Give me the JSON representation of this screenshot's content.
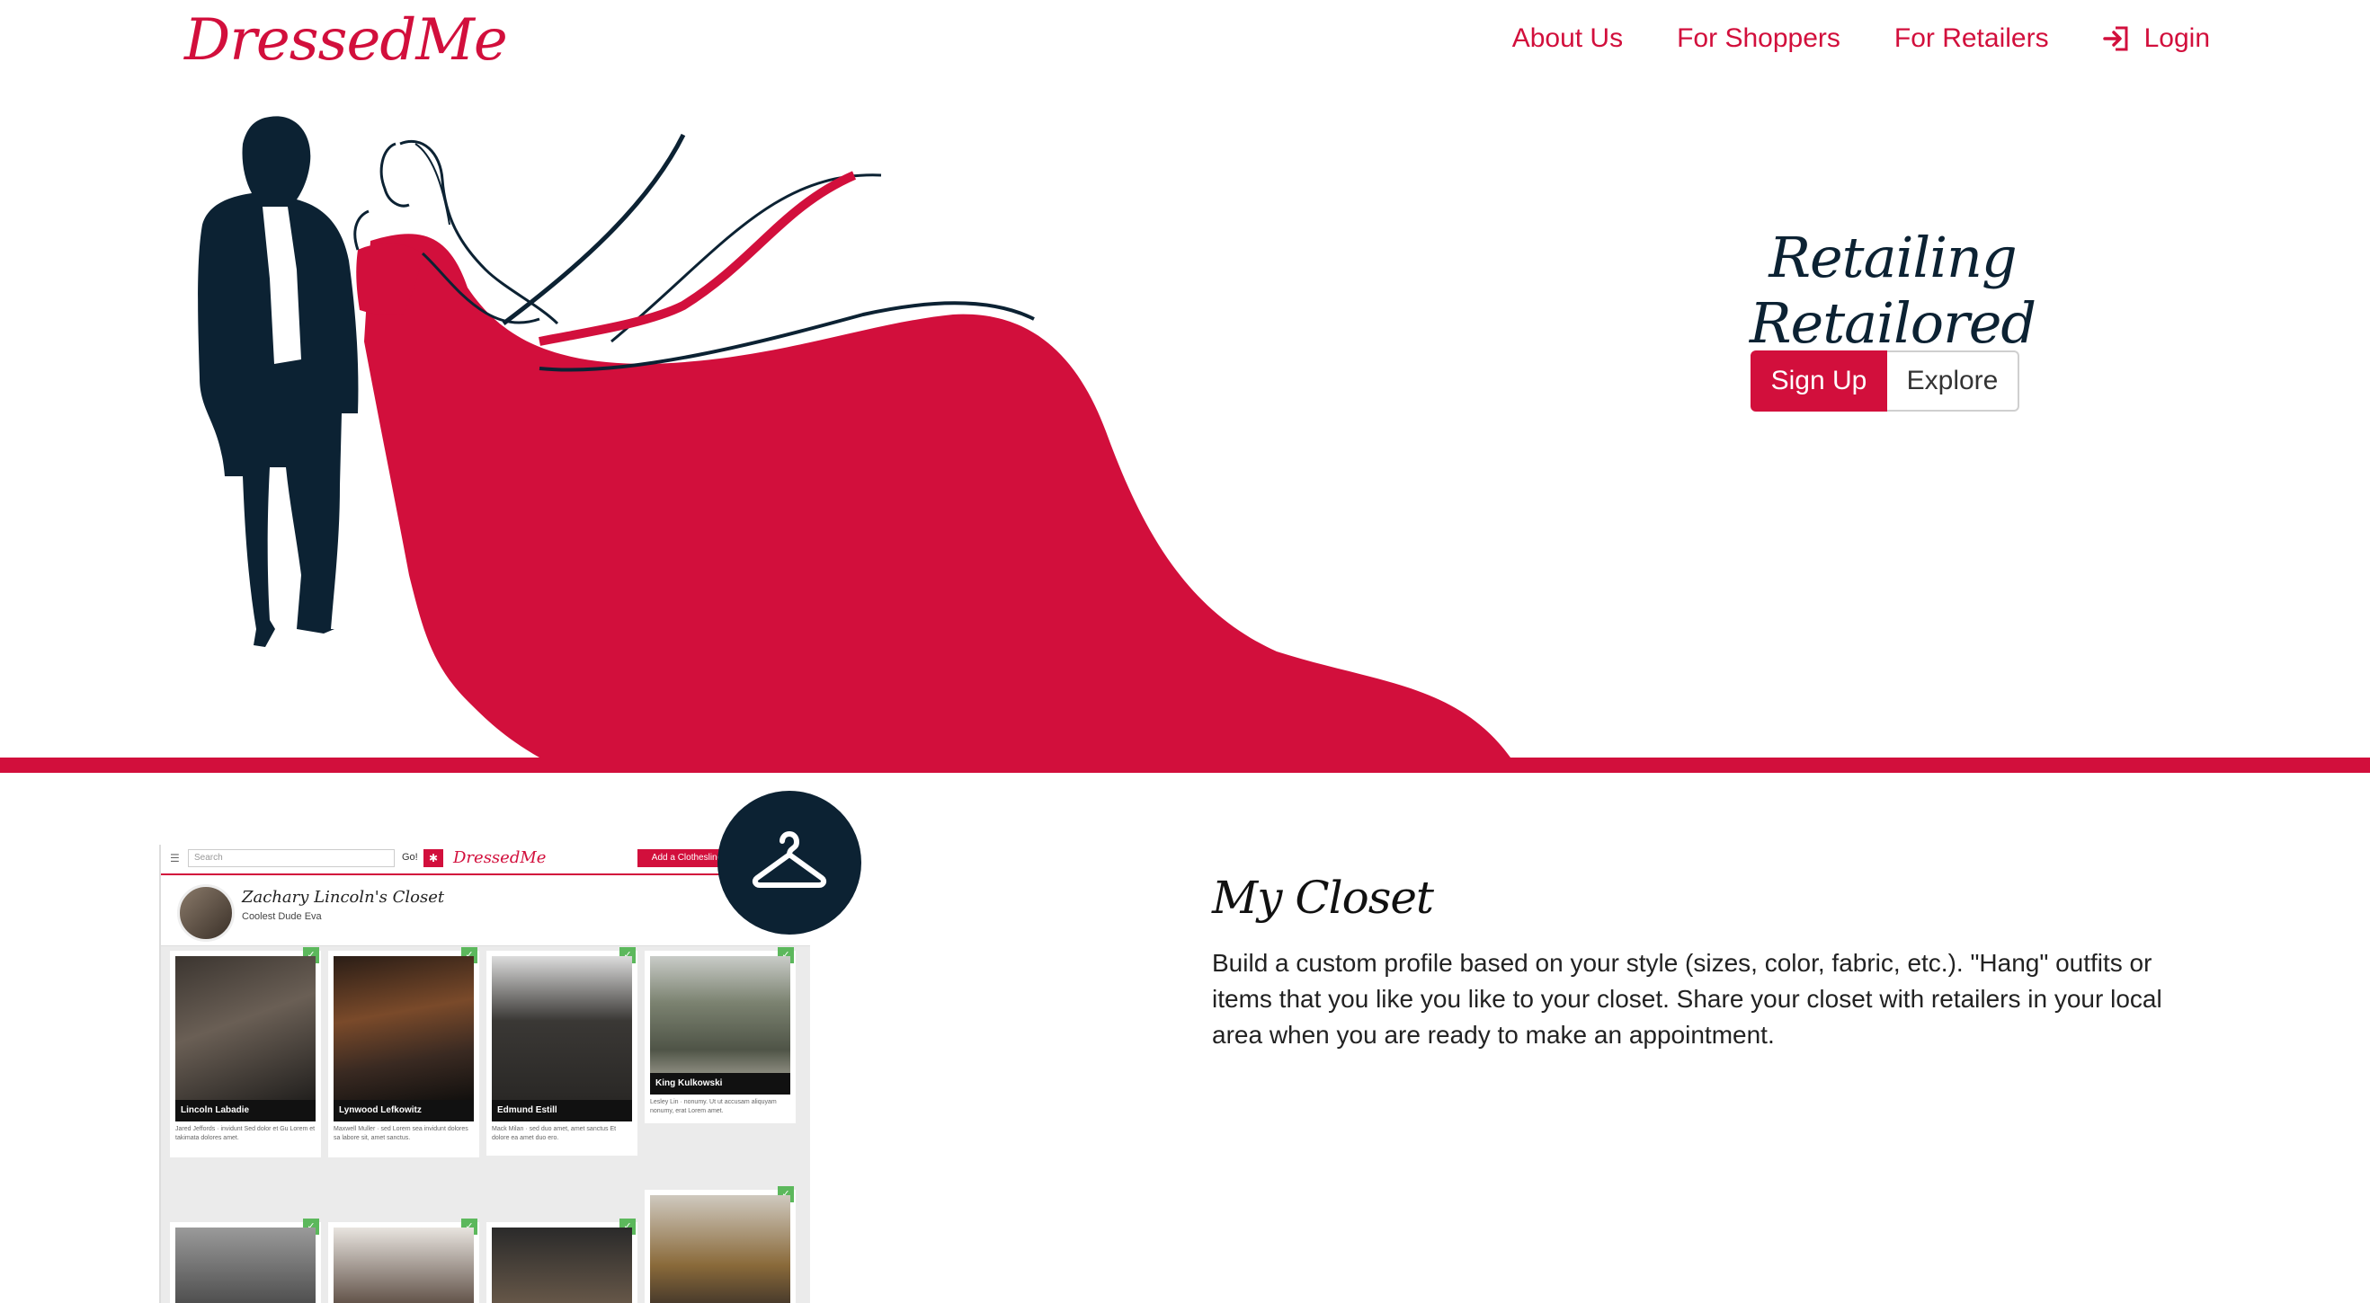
{
  "brand": {
    "logo_text": "DressedMe",
    "accent_color": "#d20f3c",
    "dark_color": "#0c2233"
  },
  "nav": {
    "items": [
      {
        "label": "About Us"
      },
      {
        "label": "For Shoppers"
      },
      {
        "label": "For Retailers"
      }
    ],
    "login": {
      "label": "Login",
      "icon": "login-icon"
    }
  },
  "hero": {
    "tagline": "Retailing Retailored",
    "signup_label": "Sign Up",
    "explore_label": "Explore"
  },
  "closet_screenshot": {
    "search_placeholder": "Search",
    "go_label": "Go!",
    "logo_text": "DressedMe",
    "add_button_label": "Add a Clothesline",
    "profile_name": "Zachary Lincoln's Closet",
    "profile_subtitle": "Coolest Dude Eva",
    "cards": [
      {
        "name": "Lincoln Labadie",
        "desc": "Jared Jeffords · invidunt Sed dolor et Gu Lorem et takimata dolores amet."
      },
      {
        "name": "Lynwood Lefkowitz",
        "desc": "Maxwell Muller · sed Lorem sea invidunt dolores sa labore sit, amet sanctus."
      },
      {
        "name": "Edmund Estill",
        "desc": "Mack Milan · sed duo amet, amet sanctus Et dolore ea amet duo ero."
      },
      {
        "name": "King Kulkowski",
        "desc": "Lesley Lin · nonumy. Ut ut accusam aliquyam nonumy, erat Lorem amet."
      }
    ]
  },
  "feature": {
    "icon": "hanger-icon",
    "title": "My Closet",
    "text": "Build a custom profile based on your style (sizes, color, fabric, etc.). \"Hang\" outfits or items that you like you like to your closet. Share your closet with retailers in your local area when you are ready to make an appointment."
  }
}
